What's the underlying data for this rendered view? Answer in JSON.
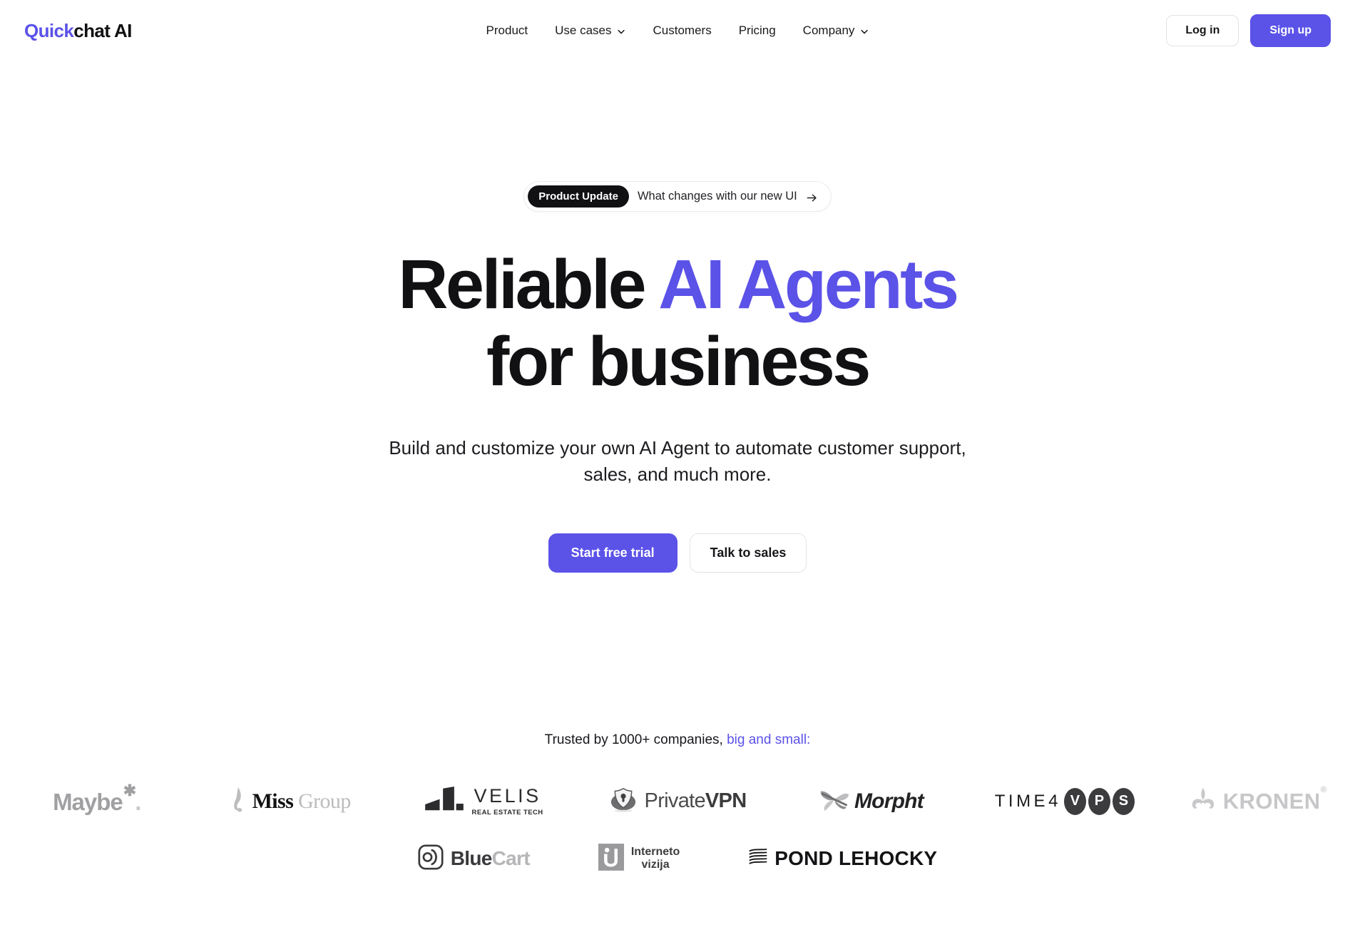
{
  "theme": {
    "accent": "#5b52e8",
    "ink": "#111114",
    "badge_bg": "#111114"
  },
  "header": {
    "logo": {
      "part1": "Quick",
      "part2": "chat AI"
    },
    "nav": [
      {
        "label": "Product",
        "has_dropdown": false,
        "icon": ""
      },
      {
        "label": "Use cases",
        "has_dropdown": true,
        "icon": "chevron-down-icon"
      },
      {
        "label": "Customers",
        "has_dropdown": false,
        "icon": ""
      },
      {
        "label": "Pricing",
        "has_dropdown": false,
        "icon": ""
      },
      {
        "label": "Company",
        "has_dropdown": true,
        "icon": "chevron-down-icon"
      }
    ],
    "login_label": "Log in",
    "signup_label": "Sign up"
  },
  "hero": {
    "badge": {
      "tag": "Product Update",
      "text": "What changes with our new UI",
      "arrow_icon": "arrow-right-icon"
    },
    "headline_line1_plain": "Reliable ",
    "headline_line1_accent": "AI Agents",
    "headline_line2": "for business",
    "subhead": "Build and customize your own AI Agent to automate customer support, sales, and much more.",
    "cta_primary": "Start free trial",
    "cta_secondary": "Talk to sales"
  },
  "trusted": {
    "text_plain": "Trusted by 1000+ companies, ",
    "text_accent": "big and small:",
    "logos_row1": [
      {
        "name": "Maybe",
        "mark": "asterisk"
      },
      {
        "name": "Miss Group",
        "word1": "Miss",
        "word2": "Group"
      },
      {
        "name": "VELIS",
        "sub": "REAL ESTATE TECH",
        "mark": "bar-chart"
      },
      {
        "name": "PrivateVPN",
        "word1": "Private",
        "word2": "VPN",
        "mark": "shield-lock"
      },
      {
        "name": "Morpht",
        "mark": "butterfly"
      },
      {
        "name": "TIME4VPS",
        "word1": "TIME4",
        "letters": [
          "V",
          "P",
          "S"
        ]
      },
      {
        "name": "KRONEN",
        "trademark": "®",
        "mark": "fleur-de-lis"
      }
    ],
    "logos_row2": [
      {
        "name": "BlueCart",
        "word1": "Blue",
        "word2": "Cart",
        "mark": "bluecart-glyph"
      },
      {
        "name": "Interneto vizija",
        "line1": "Interneto",
        "line2": "vizija",
        "mark": "iv-square"
      },
      {
        "name": "POND LEHOCKY",
        "word1": "POND LEHOCKY",
        "mark": "waves"
      }
    ]
  }
}
